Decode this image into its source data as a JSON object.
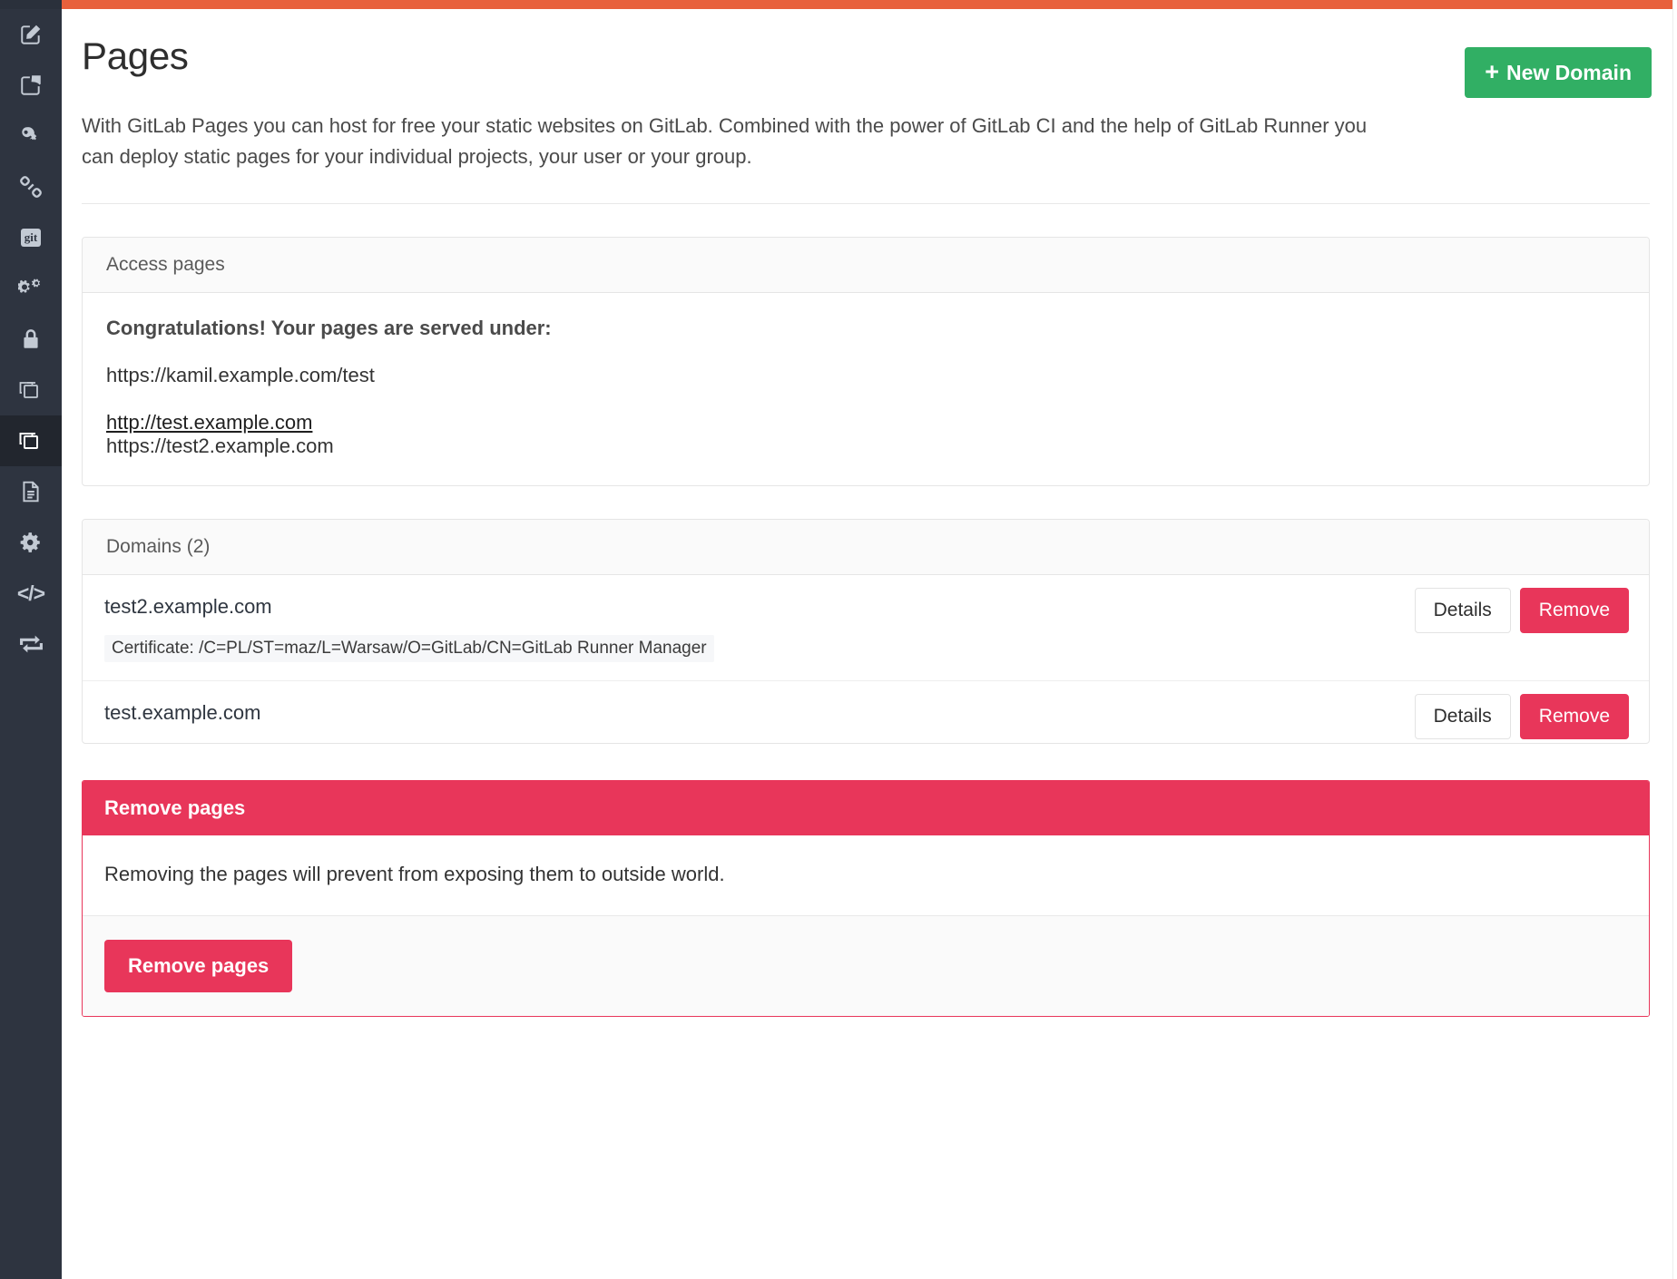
{
  "theme": {
    "accent_orange": "#e8603c",
    "sidebar_bg": "#2e3440",
    "sidebar_active_bg": "#22262e",
    "green": "#31af64",
    "danger": "#e8365a"
  },
  "sidebar": {
    "items": [
      {
        "icon": "edit-pencil-icon",
        "active": false
      },
      {
        "icon": "share-export-icon",
        "active": false
      },
      {
        "icon": "key-icon",
        "active": false
      },
      {
        "icon": "link-chain-icon",
        "active": false
      },
      {
        "icon": "git-icon",
        "label": "git",
        "active": false
      },
      {
        "icon": "gears-icon",
        "active": false
      },
      {
        "icon": "lock-icon",
        "active": false
      },
      {
        "icon": "copy-icon",
        "active": false
      },
      {
        "icon": "copy-active-icon",
        "active": true
      },
      {
        "icon": "document-icon",
        "active": false
      },
      {
        "icon": "gear-icon",
        "active": false
      },
      {
        "icon": "code-icon",
        "label": "</>",
        "active": false
      },
      {
        "icon": "repeat-sync-icon",
        "active": false
      }
    ]
  },
  "header": {
    "title": "Pages",
    "new_domain_label": "New Domain",
    "new_domain_plus": "+",
    "description": "With GitLab Pages you can host for free your static websites on GitLab. Combined with the power of GitLab CI and the help of GitLab Runner you can deploy static pages for your individual projects, your user or your group."
  },
  "access_pages": {
    "panel_title": "Access pages",
    "congrats": "Congratulations! Your pages are served under:",
    "urls": [
      {
        "text": "https://kamil.example.com/test",
        "is_link": false
      },
      {
        "text": "http://test.example.com",
        "is_link": true
      },
      {
        "text": "https://test2.example.com",
        "is_link": false
      }
    ]
  },
  "domains": {
    "panel_title": "Domains (2)",
    "details_label": "Details",
    "remove_label": "Remove",
    "rows": [
      {
        "name": "test2.example.com",
        "certificate": "Certificate: /C=PL/ST=maz/L=Warsaw/O=GitLab/CN=GitLab Runner Manager"
      },
      {
        "name": "test.example.com",
        "certificate": ""
      }
    ]
  },
  "remove_pages": {
    "panel_title": "Remove pages",
    "body_text": "Removing the pages will prevent from exposing them to outside world.",
    "button_label": "Remove pages"
  }
}
